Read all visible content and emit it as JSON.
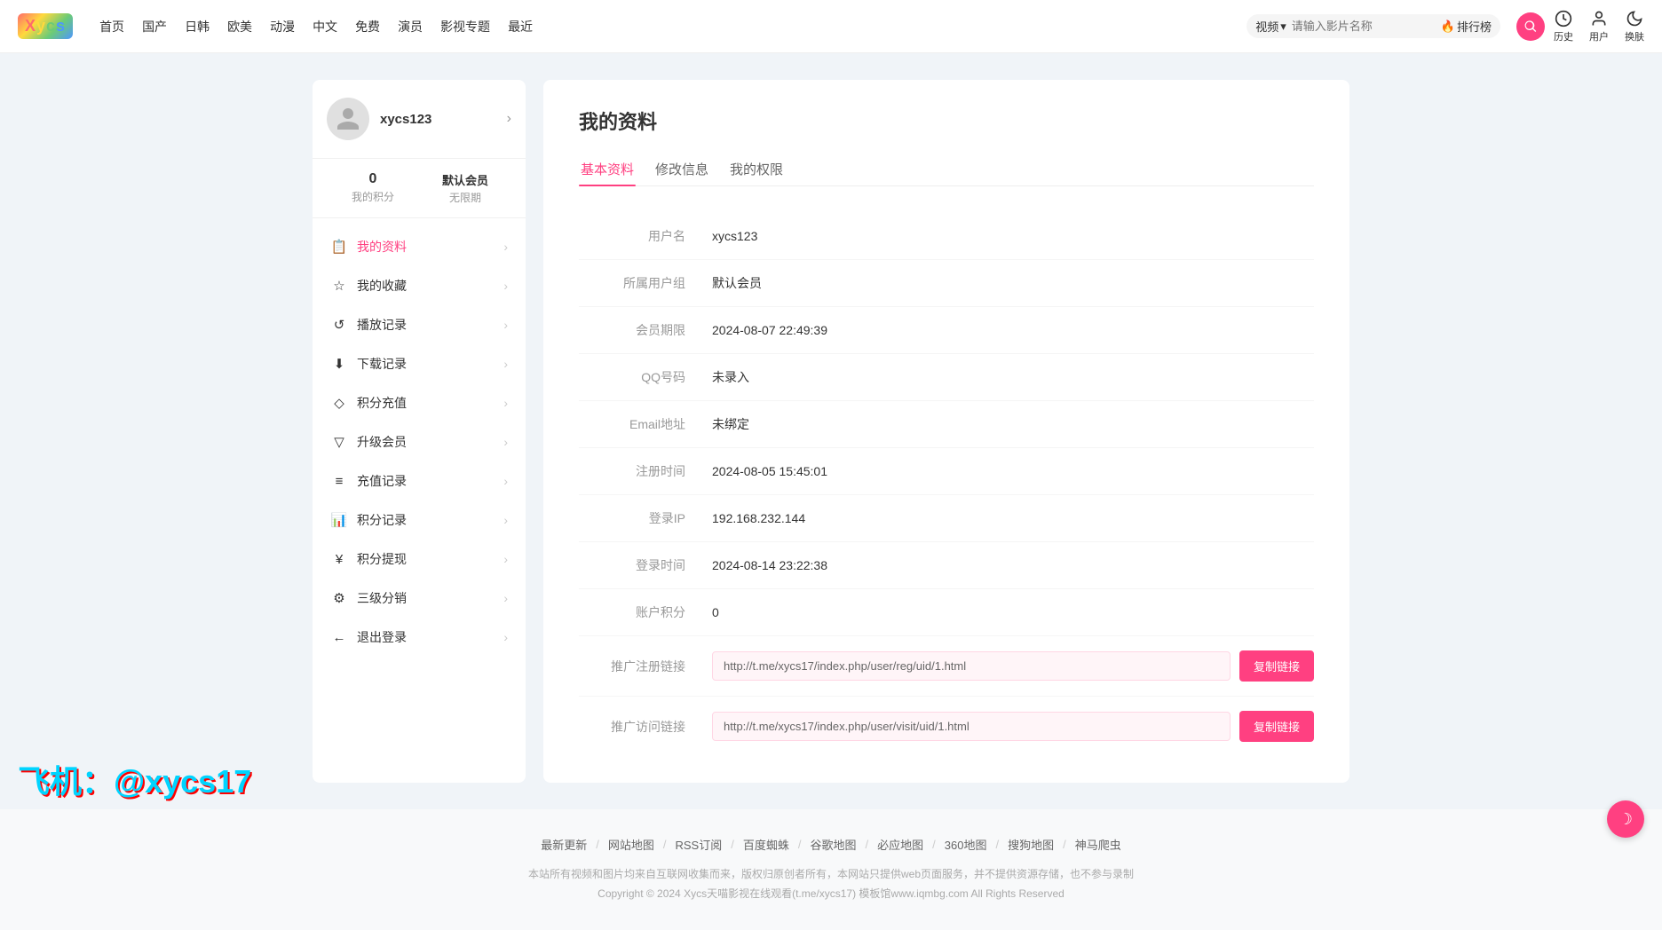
{
  "logo": {
    "text": "Xycs",
    "colorLetters": [
      "X",
      "y",
      "c",
      "s"
    ]
  },
  "nav": {
    "links": [
      "首页",
      "国产",
      "日韩",
      "欧美",
      "动漫",
      "中文",
      "免费",
      "演员",
      "影视专题",
      "最近"
    ],
    "search": {
      "dropdown_label": "视频",
      "placeholder": "请输入影片名称",
      "ranking_label": "排行榜"
    },
    "actions": {
      "history_label": "历史",
      "user_label": "用户",
      "theme_label": "换肤"
    }
  },
  "sidebar": {
    "username": "xycs123",
    "stats": {
      "points_value": "0",
      "points_label": "我的积分",
      "vip_value": "默认会员",
      "vip_label": "无限期"
    },
    "menu_items": [
      {
        "id": "my-profile",
        "icon": "📋",
        "label": "我的资料",
        "active": true
      },
      {
        "id": "my-favorites",
        "icon": "☆",
        "label": "我的收藏",
        "active": false
      },
      {
        "id": "play-history",
        "icon": "↺",
        "label": "播放记录",
        "active": false
      },
      {
        "id": "download-history",
        "icon": "↓",
        "label": "下载记录",
        "active": false
      },
      {
        "id": "points-recharge",
        "icon": "◇",
        "label": "积分充值",
        "active": false
      },
      {
        "id": "upgrade-vip",
        "icon": "▽",
        "label": "升级会员",
        "active": false
      },
      {
        "id": "recharge-history",
        "icon": "≡",
        "label": "充值记录",
        "active": false
      },
      {
        "id": "points-history",
        "icon": "📊",
        "label": "积分记录",
        "active": false
      },
      {
        "id": "points-withdraw",
        "icon": "¥",
        "label": "积分提现",
        "active": false
      },
      {
        "id": "three-level-sales",
        "icon": "⚙",
        "label": "三级分销",
        "active": false
      },
      {
        "id": "logout",
        "icon": "←",
        "label": "退出登录",
        "active": false
      }
    ]
  },
  "main": {
    "page_title": "我的资料",
    "tabs": [
      "基本资料",
      "修改信息",
      "我的权限"
    ],
    "active_tab": 0,
    "info_rows": [
      {
        "label": "用户名",
        "value": "xycs123",
        "type": "text"
      },
      {
        "label": "所属用户组",
        "value": "默认会员",
        "type": "text"
      },
      {
        "label": "会员期限",
        "value": "2024-08-07 22:49:39",
        "type": "text"
      },
      {
        "label": "QQ号码",
        "value": "未录入",
        "type": "text"
      },
      {
        "label": "Email地址",
        "value": "未绑定",
        "type": "text"
      },
      {
        "label": "注册时间",
        "value": "2024-08-05 15:45:01",
        "type": "text"
      },
      {
        "label": "登录IP",
        "value": "192.168.232.144",
        "type": "text"
      },
      {
        "label": "登录时间",
        "value": "2024-08-14 23:22:38",
        "type": "text"
      },
      {
        "label": "账户积分",
        "value": "0",
        "type": "text"
      },
      {
        "label": "推广注册链接",
        "value": "http://t.me/xycs17/index.php/user/reg/uid/1.html",
        "type": "link",
        "button_label": "复制链接"
      },
      {
        "label": "推广访问链接",
        "value": "http://t.me/xycs17/index.php/user/visit/uid/1.html",
        "type": "link",
        "button_label": "复制链接"
      }
    ]
  },
  "footer": {
    "links": [
      "最新更新",
      "网站地图",
      "RSS订阅",
      "百度蜘蛛",
      "谷歌地图",
      "必应地图",
      "360地图",
      "搜狗地图",
      "神马爬虫"
    ],
    "desc1": "本站所有视频和图片均来自互联网收集而来，版权归原创者所有，本网站只提供web页面服务，并不提供资源存储，也不参与录制",
    "desc2": "Copyright © 2024 Xycs天喵影视在线观看(t.me/xycs17) 模板馆www.iqmbg.com All Rights Reserved"
  },
  "watermark": "飞机：@xycs17",
  "dark_toggle": "☽"
}
